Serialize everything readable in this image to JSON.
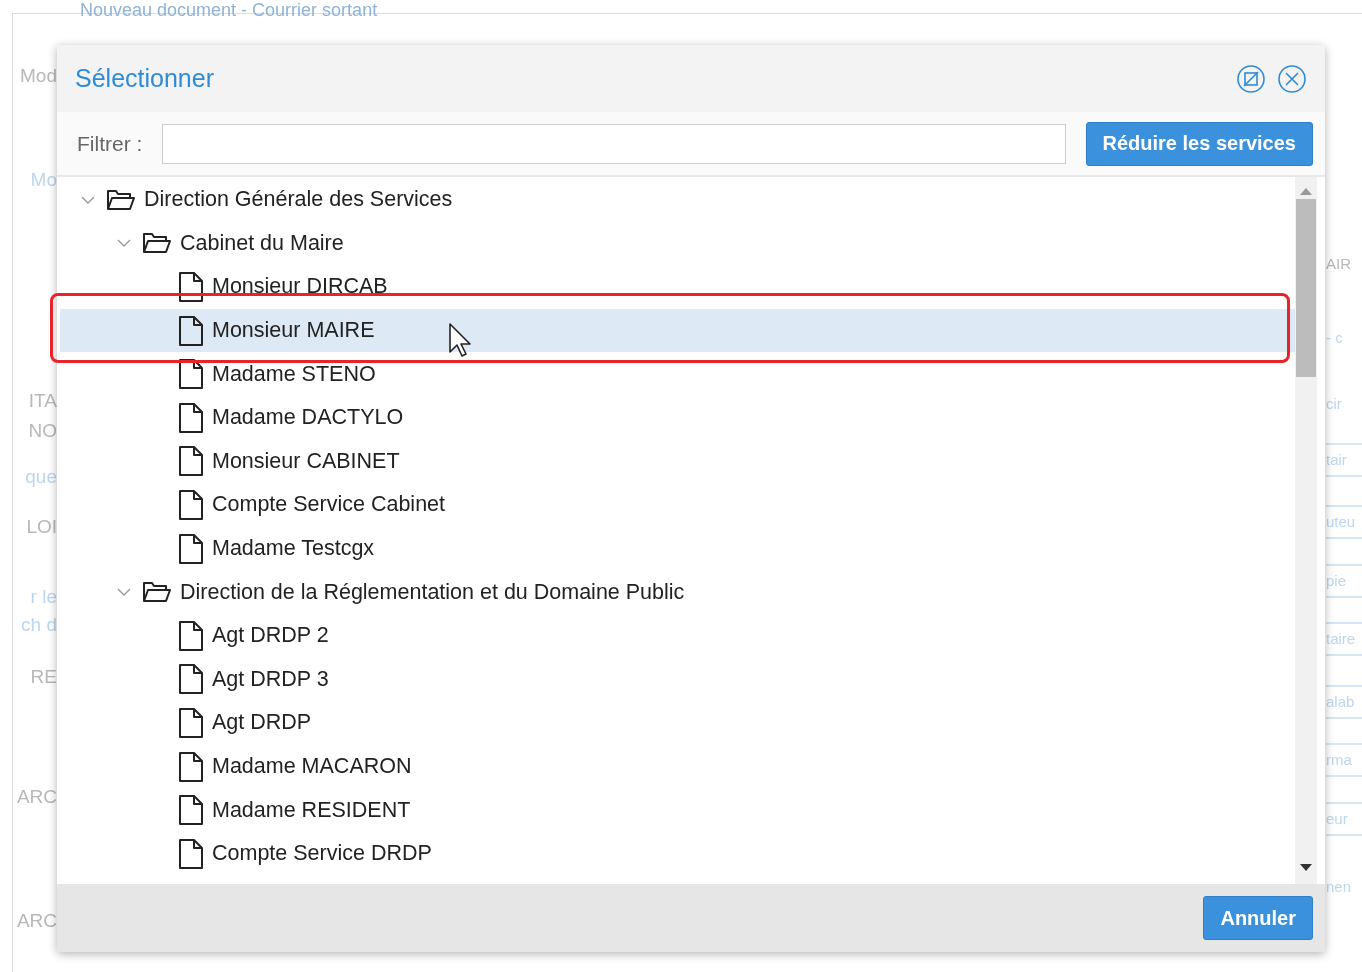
{
  "background_page": {
    "title": "Nouveau document - Courrier sortant",
    "left_fragments": [
      {
        "text": "Mod",
        "kind": "text"
      },
      {
        "text": "Mo",
        "kind": "link"
      },
      {
        "text": "ITA",
        "kind": "text"
      },
      {
        "text": "NO",
        "kind": "text"
      },
      {
        "text": "que",
        "kind": "link"
      },
      {
        "text": "LOI",
        "kind": "text"
      },
      {
        "text": "r le",
        "kind": "link"
      },
      {
        "text": "ch d",
        "kind": "link"
      },
      {
        "text": "RE",
        "kind": "text"
      },
      {
        "text": "ARC",
        "kind": "text"
      },
      {
        "text": "ARC",
        "kind": "text"
      }
    ],
    "right_fragments": [
      {
        "text": "AIR",
        "kind": "text"
      },
      {
        "text": "- c",
        "kind": "link"
      },
      {
        "text": "cir",
        "kind": "link"
      },
      {
        "text": "tair",
        "kind": "tag"
      },
      {
        "text": "uteu",
        "kind": "tag"
      },
      {
        "text": "pie",
        "kind": "tag"
      },
      {
        "text": "taire",
        "kind": "tag"
      },
      {
        "text": "alab",
        "kind": "tag"
      },
      {
        "text": "rma",
        "kind": "tag"
      },
      {
        "text": "eur",
        "kind": "tag"
      },
      {
        "text": "nen",
        "kind": "link"
      }
    ]
  },
  "dialog": {
    "title": "Sélectionner",
    "filter_label": "Filtrer :",
    "reduce_button": "Réduire les services",
    "tree": [
      {
        "label": "Direction Générale des Services",
        "kind": "folder",
        "expanded": true,
        "selected": false,
        "children": [
          {
            "label": "Cabinet du Maire",
            "kind": "folder",
            "expanded": true,
            "selected": false,
            "children": [
              {
                "label": "Monsieur DIRCAB",
                "kind": "user",
                "selected": false
              },
              {
                "label": "Monsieur MAIRE",
                "kind": "user",
                "selected": true
              },
              {
                "label": "Madame STENO",
                "kind": "user",
                "selected": false
              },
              {
                "label": "Madame DACTYLO",
                "kind": "user",
                "selected": false
              },
              {
                "label": "Monsieur CABINET",
                "kind": "user",
                "selected": false
              },
              {
                "label": "Compte Service Cabinet",
                "kind": "user",
                "selected": false
              },
              {
                "label": "Madame Testcgx",
                "kind": "user",
                "selected": false
              }
            ]
          },
          {
            "label": "Direction de la Réglementation et du Domaine Public",
            "kind": "folder",
            "expanded": true,
            "selected": false,
            "children": [
              {
                "label": "Agt DRDP 2",
                "kind": "user",
                "selected": false
              },
              {
                "label": "Agt DRDP 3",
                "kind": "user",
                "selected": false
              },
              {
                "label": "Agt DRDP",
                "kind": "user",
                "selected": false
              },
              {
                "label": "Madame MACARON",
                "kind": "user",
                "selected": false
              },
              {
                "label": "Madame RESIDENT",
                "kind": "user",
                "selected": false
              },
              {
                "label": "Compte Service DRDP",
                "kind": "user",
                "selected": false
              }
            ]
          }
        ]
      }
    ],
    "cancel_button": "Annuler"
  }
}
